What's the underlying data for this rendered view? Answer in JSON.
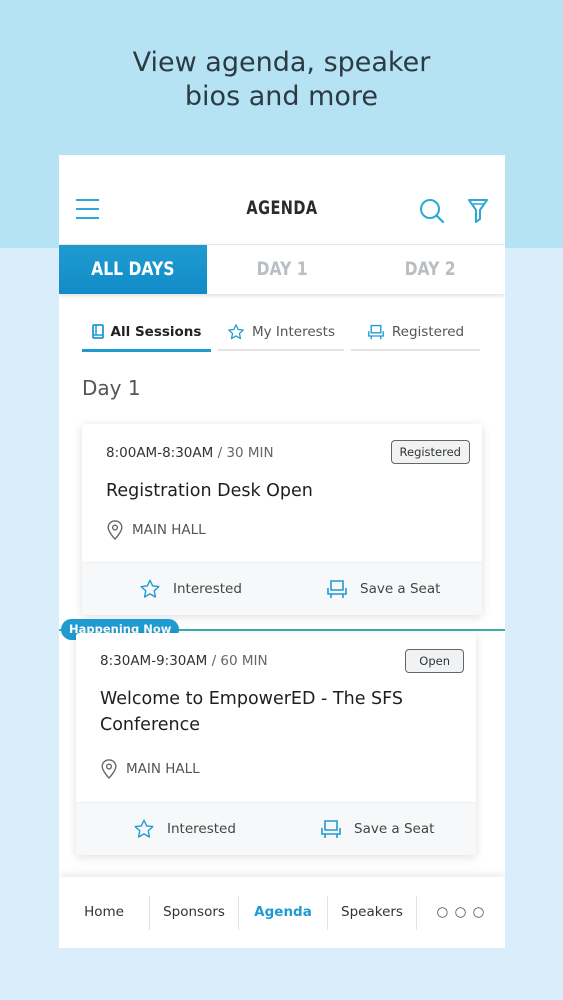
{
  "headline": {
    "line1": "View agenda, speaker",
    "line2": "bios and more"
  },
  "header": {
    "title": "AGENDA",
    "menu_icon": "hamburger-icon",
    "search_icon": "search-icon",
    "filter_icon": "filter-icon"
  },
  "day_tabs": [
    {
      "label": "ALL DAYS",
      "active": true
    },
    {
      "label": "DAY 1",
      "active": false
    },
    {
      "label": "DAY 2",
      "active": false
    }
  ],
  "filter_tabs": [
    {
      "label": "All Sessions",
      "icon": "book-icon",
      "active": true
    },
    {
      "label": "My Interests",
      "icon": "star-icon",
      "active": false
    },
    {
      "label": "Registered",
      "icon": "seat-icon",
      "active": false
    }
  ],
  "day_label": "Day 1",
  "happening_now": "Happening Now",
  "sessions": [
    {
      "time": "8:00AM-8:30AM",
      "duration": " / 30 MIN",
      "badge": "Registered",
      "title_line1": "Registration Desk Open",
      "title_line2": "",
      "location": "MAIN HALL",
      "interested": "Interested",
      "save_seat": "Save a Seat"
    },
    {
      "time": "8:30AM-9:30AM",
      "duration": " / 60 MIN",
      "badge": "Open",
      "title_line1": "Welcome to EmpowerED - The SFS",
      "title_line2": "Conference",
      "location": "MAIN HALL",
      "interested": "Interested",
      "save_seat": "Save a Seat"
    }
  ],
  "bottom_nav": [
    {
      "label": "Home",
      "active": false
    },
    {
      "label": "Sponsors",
      "active": false
    },
    {
      "label": "Agenda",
      "active": true
    },
    {
      "label": "Speakers",
      "active": false
    },
    {
      "label": "○ ○ ○",
      "active": false
    }
  ],
  "colors": {
    "accent": "#1f9bd1",
    "happening_line": "#3aaea7",
    "top_band": "#b6e3f4",
    "lower_band": "#d9eefa"
  }
}
